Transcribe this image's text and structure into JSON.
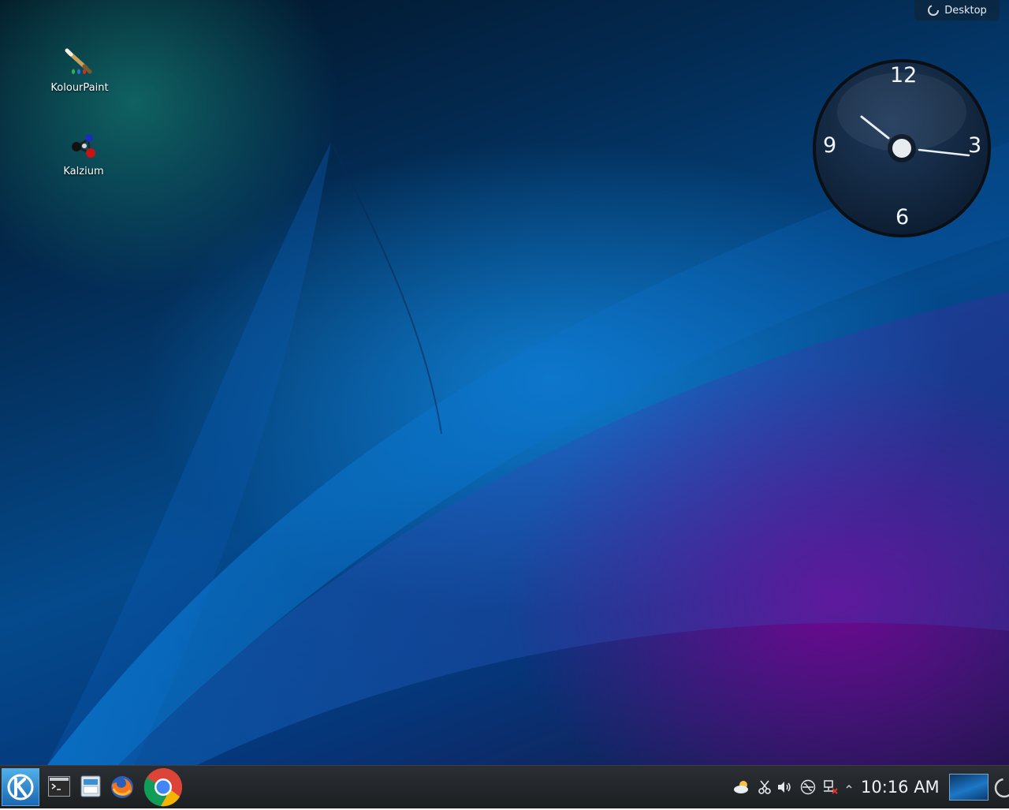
{
  "desktop": {
    "toolbox_label": "Desktop",
    "icons": [
      {
        "label": "KolourPaint",
        "icon": "kolourpaint-icon"
      },
      {
        "label": "Kalzium",
        "icon": "kalzium-icon"
      }
    ]
  },
  "clock_widget": {
    "numerals": [
      "12",
      "3",
      "6",
      "9"
    ],
    "time": "10:16"
  },
  "taskbar": {
    "launchers": [
      {
        "name": "kickoff-menu",
        "icon": "kde-logo-icon"
      },
      {
        "name": "konsole",
        "icon": "terminal-icon"
      },
      {
        "name": "file-manager",
        "icon": "folder-icon"
      },
      {
        "name": "firefox",
        "icon": "firefox-icon"
      },
      {
        "name": "chrome",
        "icon": "chrome-icon"
      }
    ],
    "tray": [
      "weather-icon",
      "clipboard-icon",
      "volume-icon",
      "usb-icon",
      "network-disconnected-icon",
      "expand-tray-icon"
    ],
    "clock": "10:16 AM"
  },
  "colors": {
    "taskbar_bg": "#1f2226",
    "accent": "#3daee9"
  }
}
